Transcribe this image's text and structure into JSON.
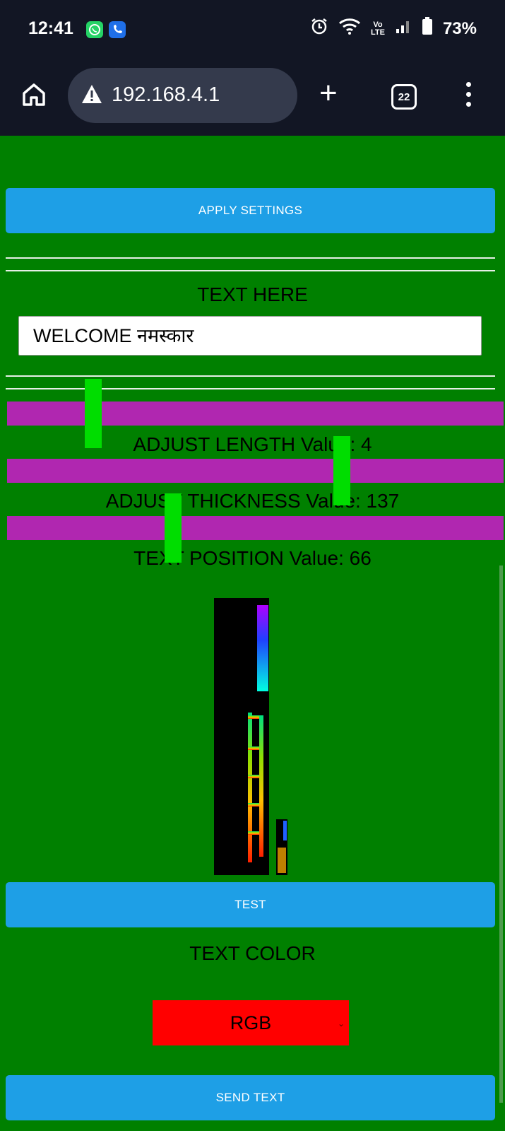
{
  "status_bar": {
    "time": "12:41",
    "battery": "73%",
    "icons": [
      "whatsapp-icon",
      "phone-app-icon",
      "alarm-icon",
      "wifi-icon",
      "volte-icon",
      "signal-icon",
      "battery-icon"
    ]
  },
  "browser": {
    "url": "192.168.4.1",
    "tab_count": "22"
  },
  "page": {
    "apply_button": "APPLY SETTINGS",
    "text_label": "TEXT HERE",
    "text_value": "WELCOME   नमस्कार",
    "length_label": "ADJUST LENGTH Value: 4",
    "thickness_label": "ADJUST THICKNESS Value: 137",
    "position_label": "TEXT POSITION Value: 66",
    "test_button": "TEST",
    "color_label": "TEXT COLOR",
    "color_selected": "RGB",
    "send_button": "SEND TEXT"
  },
  "sliders": {
    "length": {
      "value": 4,
      "fill_fraction": 0.16
    },
    "thickness": {
      "value": 137,
      "fill_fraction": 0.67
    },
    "position": {
      "value": 66,
      "fill_fraction": 0.32
    }
  },
  "colors": {
    "background": "#008000",
    "button": "#1e9fe6",
    "slider_track": "#b027b0",
    "slider_thumb": "#00dd00",
    "select": "#ff0000",
    "chrome": "#121624"
  }
}
